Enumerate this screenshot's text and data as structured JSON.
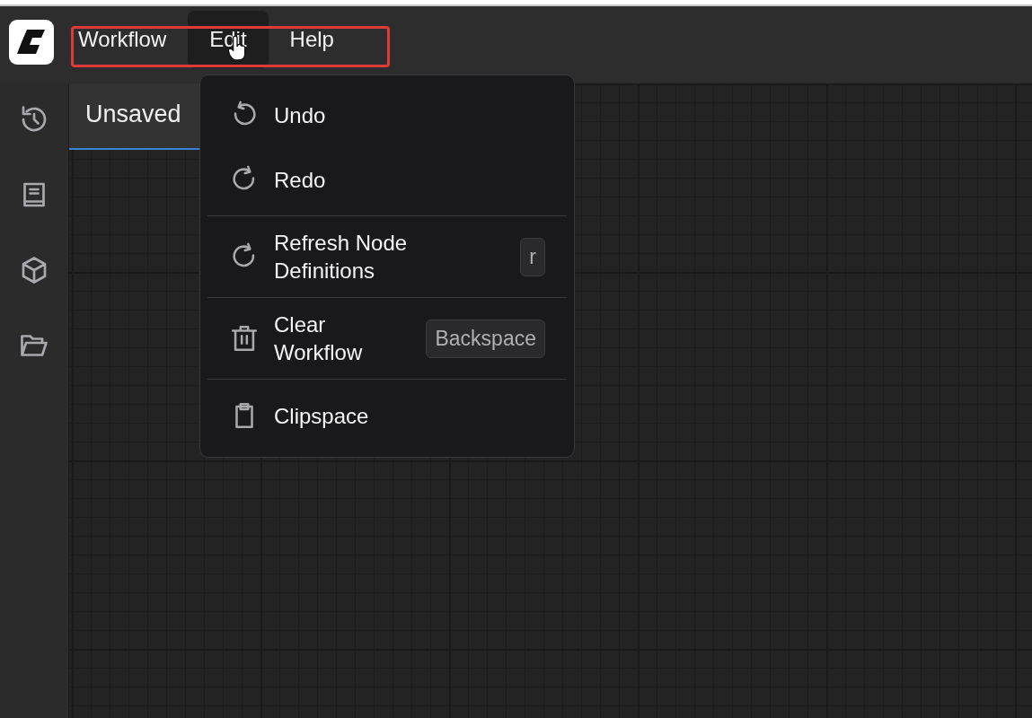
{
  "menubar": [
    {
      "label": "Workflow",
      "selected": false
    },
    {
      "label": "Edit",
      "selected": true
    },
    {
      "label": "Help",
      "selected": false
    }
  ],
  "sidebar": {
    "items": [
      {
        "kind": "history"
      },
      {
        "kind": "book"
      },
      {
        "kind": "cube"
      },
      {
        "kind": "folder"
      }
    ]
  },
  "tabs": [
    {
      "title": "Unsaved",
      "selected": true
    }
  ],
  "edit_menu": {
    "items": [
      {
        "kind": "undo",
        "label": "Undo"
      },
      {
        "kind": "redo",
        "label": "Redo"
      },
      {
        "kind": "divider"
      },
      {
        "kind": "redo",
        "label": "Refresh Node Definitions",
        "shortcut": "r"
      },
      {
        "kind": "divider"
      },
      {
        "kind": "trash",
        "label": "Clear Workflow",
        "shortcut": "Backspace"
      },
      {
        "kind": "divider"
      },
      {
        "kind": "clipboard",
        "label": "Clipspace"
      }
    ]
  }
}
